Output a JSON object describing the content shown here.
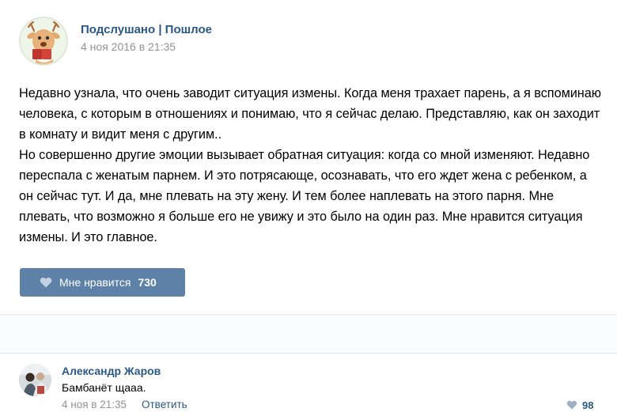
{
  "post": {
    "group_name": "Подслушано | Пошлое",
    "date": "4 ноя 2016 в 21:35",
    "paragraphs": [
      "Недавно узнала, что очень заводит ситуация измены. Когда меня трахает парень, а я вспоминаю человека, с которым в отношениях и понимаю, что я сейчас делаю. Представляю, как он заходит в комнату и видит меня с другим..",
      "Но совершенно другие эмоции вызывает обратная ситуация: когда со мной изменяют. Недавно переспала с женатым парнем. И это потрясающе, осознавать, что его ждет жена с ребенком, а он сейчас тут. И да, мне плевать на эту жену. И тем более наплевать на этого парня. Мне плевать, что возможно я больше его не увижу и это было на один раз. Мне нравится ситуация измены. И это главное."
    ],
    "like_label": "Мне нравится",
    "like_count": "730"
  },
  "comment": {
    "author": "Александр Жаров",
    "text": "Бамбанёт щааа.",
    "date": "4 ноя в 21:35",
    "reply_label": "Ответить",
    "like_count": "98"
  },
  "colors": {
    "link": "#2a5885",
    "button": "#5e81a8",
    "meta": "#939393"
  },
  "icons": {
    "group_avatar": "deer-avatar-icon",
    "like": "heart-icon"
  }
}
